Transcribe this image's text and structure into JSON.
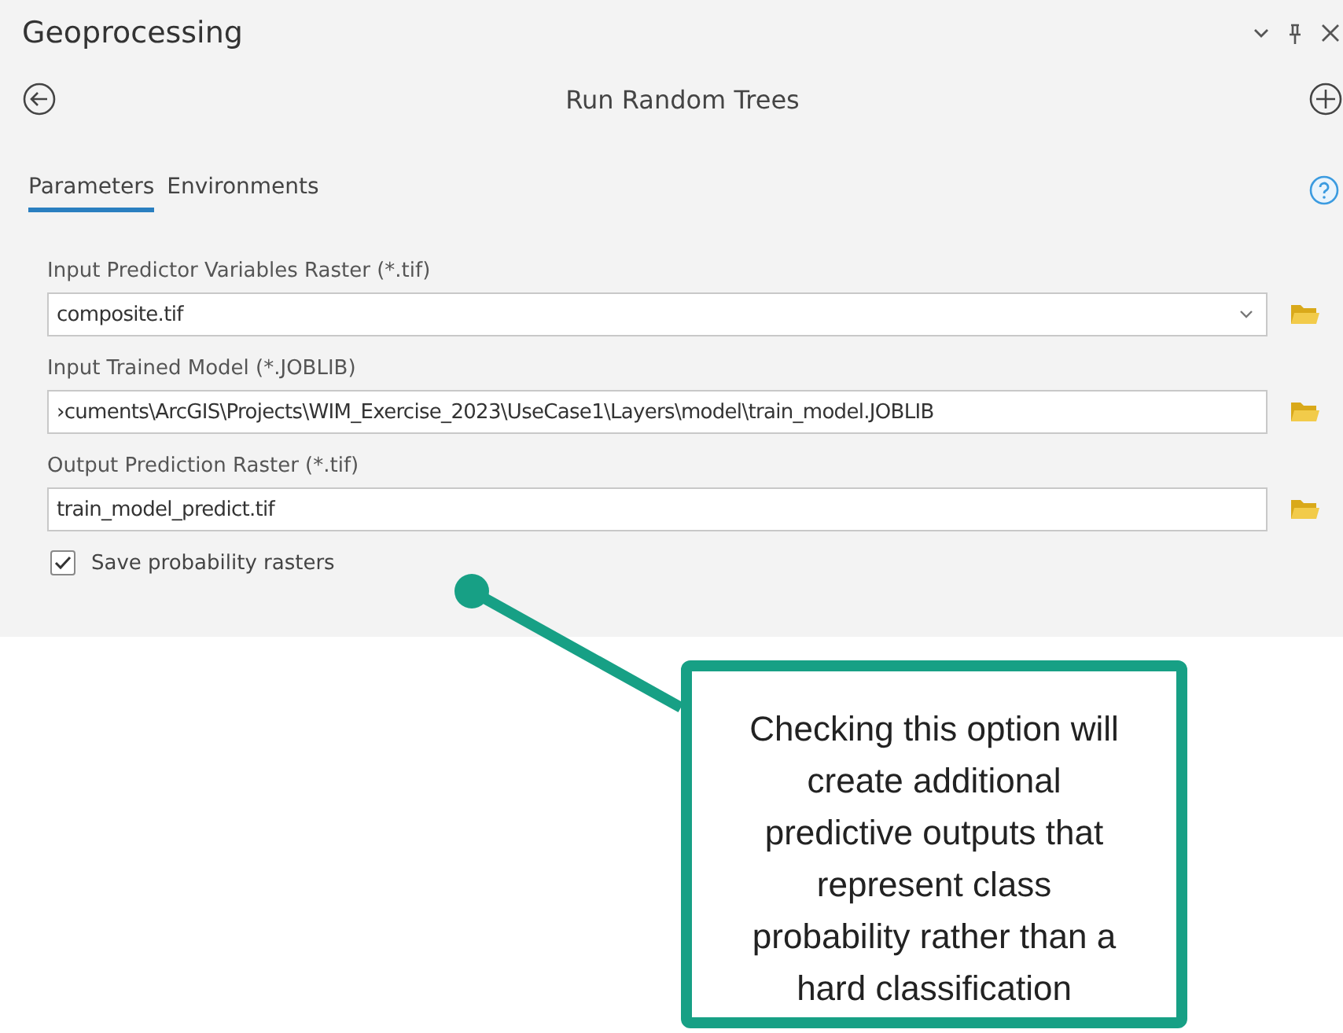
{
  "window": {
    "title": "Geoprocessing"
  },
  "tool": {
    "title": "Run Random Trees"
  },
  "tabs": [
    {
      "label": "Parameters",
      "selected": true
    },
    {
      "label": "Environments",
      "selected": false
    }
  ],
  "parameters": [
    {
      "label": "Input Predictor Variables Raster (*.tif)",
      "value": "composite.tif",
      "kind": "dropdown"
    },
    {
      "label": "Input Trained Model (*.JOBLIB)",
      "value": "›cuments\\ArcGIS\\Projects\\WIM_Exercise_2023\\UseCase1\\Layers\\model\\train_model.JOBLIB",
      "kind": "text"
    },
    {
      "label": "Output Prediction Raster (*.tif)",
      "value": "train_model_predict.tif",
      "kind": "text"
    }
  ],
  "options": [
    {
      "label": "Save probability rasters",
      "checked": true
    }
  ],
  "callout": {
    "text": "Checking this option will create additional predictive outputs that represent class probability rather than a hard classification"
  }
}
